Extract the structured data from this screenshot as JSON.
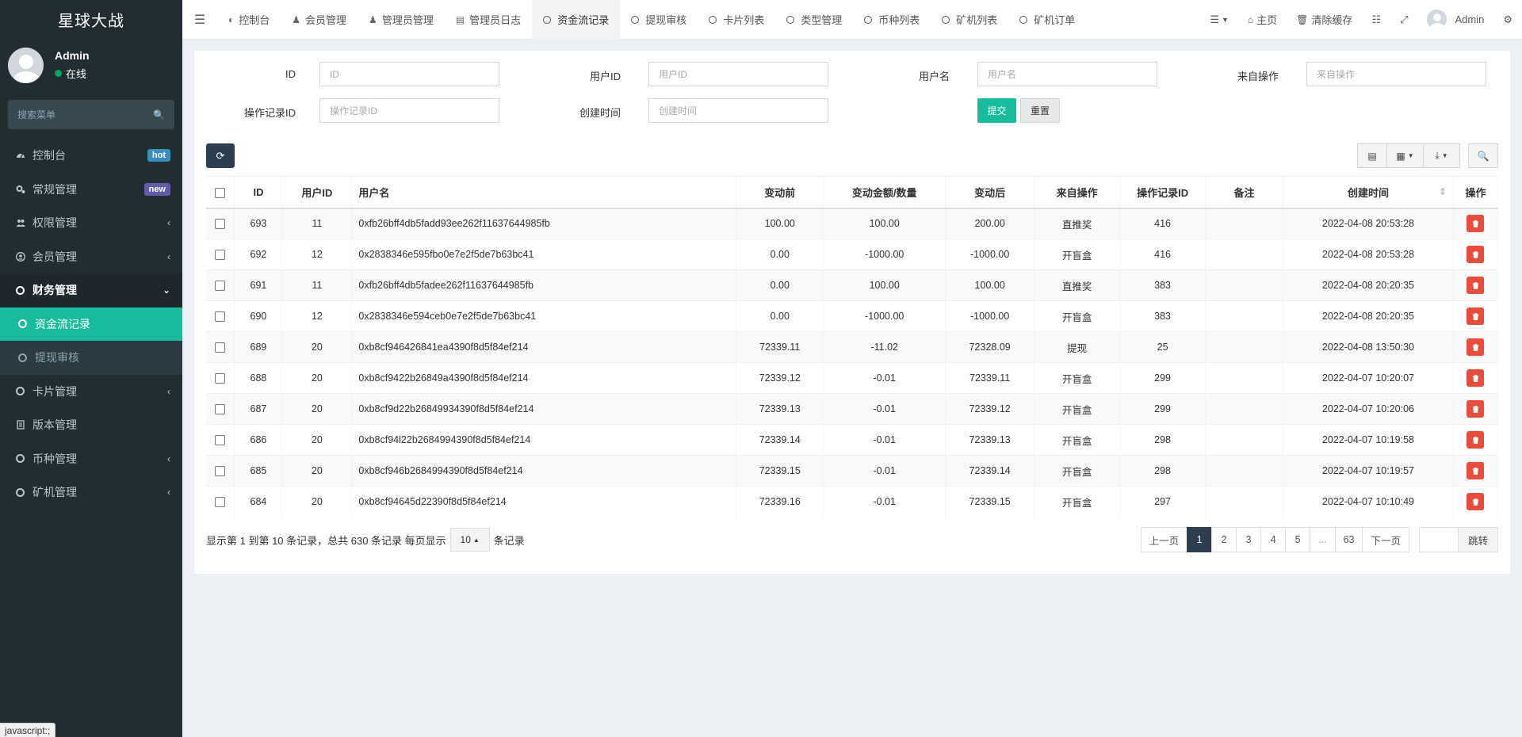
{
  "app": {
    "title": "星球大战"
  },
  "user": {
    "name": "Admin",
    "status": "在线"
  },
  "sidebar": {
    "search_placeholder": "搜索菜单",
    "items": [
      {
        "label": "控制台",
        "icon": "dashboard-icon",
        "badge": "hot"
      },
      {
        "label": "常规管理",
        "icon": "cogs-icon",
        "badge": "new"
      },
      {
        "label": "权限管理",
        "icon": "group-icon"
      },
      {
        "label": "会员管理",
        "icon": "user-circle-icon"
      },
      {
        "label": "财务管理",
        "icon": "circle-icon"
      },
      {
        "label": "资金流记录"
      },
      {
        "label": "提现审核"
      },
      {
        "label": "卡片管理",
        "icon": "circle-icon"
      },
      {
        "label": "版本管理",
        "icon": "file-icon"
      },
      {
        "label": "币种管理",
        "icon": "circle-icon"
      },
      {
        "label": "矿机管理",
        "icon": "circle-icon"
      }
    ]
  },
  "topbar": {
    "tabs": [
      "控制台",
      "会员管理",
      "管理员管理",
      "管理员日志",
      "资金流记录",
      "提现审核",
      "卡片列表",
      "类型管理",
      "币种列表",
      "矿机列表",
      "矿机订单"
    ],
    "home": "主页",
    "clear_cache": "清除缓存",
    "admin": "Admin"
  },
  "filters": {
    "id_label": "ID",
    "id_placeholder": "ID",
    "uid_label": "用户ID",
    "uid_placeholder": "用户ID",
    "uname_label": "用户名",
    "uname_placeholder": "用户名",
    "from_label": "来自操作",
    "from_placeholder": "来自操作",
    "oid_label": "操作记录ID",
    "oid_placeholder": "操作记录ID",
    "time_label": "创建时间",
    "time_placeholder": "创建时间",
    "submit": "提交",
    "reset": "重置"
  },
  "table": {
    "headers": [
      "ID",
      "用户ID",
      "用户名",
      "变动前",
      "变动金额/数量",
      "变动后",
      "来自操作",
      "操作记录ID",
      "备注",
      "创建时间",
      "操作"
    ],
    "rows": [
      [
        "693",
        "11",
        "0xfb26bff4db5fadd93ee262f11637644985fb",
        "100.00",
        "100.00",
        "200.00",
        "直推奖",
        "416",
        "",
        "2022-04-08 20:53:28"
      ],
      [
        "692",
        "12",
        "0x2838346e595fbo0e7e2f5de7b63bc41",
        "0.00",
        "-1000.00",
        "-1000.00",
        "开盲盒",
        "416",
        "",
        "2022-04-08 20:53:28"
      ],
      [
        "691",
        "11",
        "0xfb26bff4db5fadee262f11637644985fb",
        "0.00",
        "100.00",
        "100.00",
        "直推奖",
        "383",
        "",
        "2022-04-08 20:20:35"
      ],
      [
        "690",
        "12",
        "0x2838346e594ceb0e7e2f5de7b63bc41",
        "0.00",
        "-1000.00",
        "-1000.00",
        "开盲盒",
        "383",
        "",
        "2022-04-08 20:20:35"
      ],
      [
        "689",
        "20",
        "0xb8cf946426841ea4390f8d5f84ef214",
        "72339.11",
        "-11.02",
        "72328.09",
        "提现",
        "25",
        "",
        "2022-04-08 13:50:30"
      ],
      [
        "688",
        "20",
        "0xb8cf9422b26849a4390f8d5f84ef214",
        "72339.12",
        "-0.01",
        "72339.11",
        "开盲盒",
        "299",
        "",
        "2022-04-07 10:20:07"
      ],
      [
        "687",
        "20",
        "0xb8cf9d22b26849934390f8d5f84ef214",
        "72339.13",
        "-0.01",
        "72339.12",
        "开盲盒",
        "299",
        "",
        "2022-04-07 10:20:06"
      ],
      [
        "686",
        "20",
        "0xb8cf94l22b2684994390f8d5f84ef214",
        "72339.14",
        "-0.01",
        "72339.13",
        "开盲盒",
        "298",
        "",
        "2022-04-07 10:19:58"
      ],
      [
        "685",
        "20",
        "0xb8cf946b2684994390f8d5f84ef214",
        "72339.15",
        "-0.01",
        "72339.14",
        "开盲盒",
        "298",
        "",
        "2022-04-07 10:19:57"
      ],
      [
        "684",
        "20",
        "0xb8cf94645d22390f8d5f84ef214",
        "72339.16",
        "-0.01",
        "72339.15",
        "开盲盒",
        "297",
        "",
        "2022-04-07 10:10:49"
      ]
    ]
  },
  "pager": {
    "info_prefix": "显示第 1 到第 10 条记录，总共 630 条记录 每页显示",
    "page_size": "10",
    "info_suffix": "条记录",
    "prev": "上一页",
    "pages": [
      "1",
      "2",
      "3",
      "4",
      "5",
      "...",
      "63"
    ],
    "next": "下一页",
    "jump": "跳转"
  },
  "statusbar": "javascript:;"
}
